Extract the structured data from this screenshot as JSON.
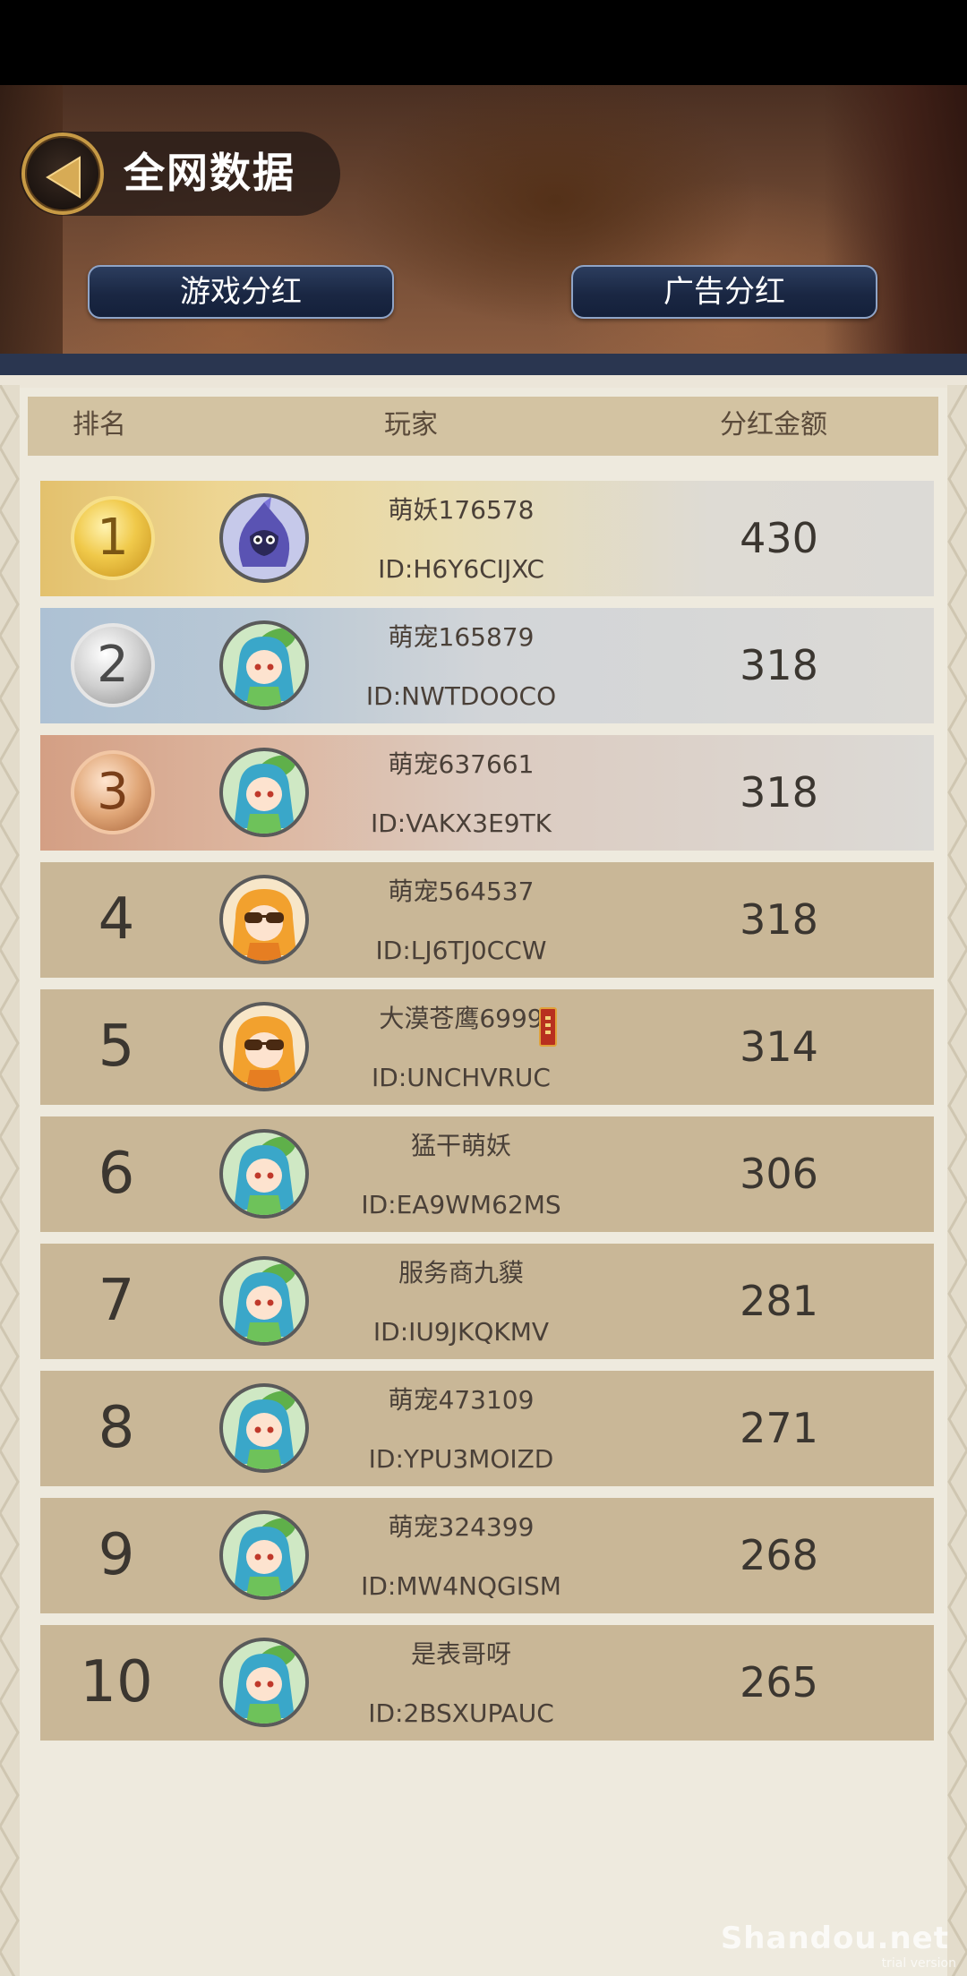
{
  "header": {
    "title": "全网数据",
    "tabs": [
      {
        "label": "游戏分红"
      },
      {
        "label": "广告分红"
      }
    ]
  },
  "table": {
    "columns": {
      "rank": "排名",
      "player": "玩家",
      "amount": "分红金额"
    },
    "rows": [
      {
        "rank": "1",
        "name": "萌妖176578",
        "id": "ID:H6Y6CIJXC",
        "amount": "430",
        "avatar": "hooded-ninja-avatar",
        "style": "gold"
      },
      {
        "rank": "2",
        "name": "萌宠165879",
        "id": "ID:NWTDOOCO",
        "amount": "318",
        "avatar": "leaf-girl-avatar",
        "style": "silver"
      },
      {
        "rank": "3",
        "name": "萌宠637661",
        "id": "ID:VAKX3E9TK",
        "amount": "318",
        "avatar": "leaf-girl-avatar",
        "style": "bronze"
      },
      {
        "rank": "4",
        "name": "萌宠564537",
        "id": "ID:LJ6TJ0CCW",
        "amount": "318",
        "avatar": "sunglasses-girl-avatar",
        "style": "plain"
      },
      {
        "rank": "5",
        "name": "大漠苍鹰6999",
        "id": "ID:UNCHVRUC",
        "amount": "314",
        "avatar": "sunglasses-girl-avatar",
        "style": "plain",
        "badge": "red-seal-icon"
      },
      {
        "rank": "6",
        "name": "猛干萌妖",
        "id": "ID:EA9WM62MS",
        "amount": "306",
        "avatar": "leaf-girl-avatar",
        "style": "plain"
      },
      {
        "rank": "7",
        "name": "服务商九貘",
        "id": "ID:IU9JKQKMV",
        "amount": "281",
        "avatar": "leaf-girl-avatar",
        "style": "plain"
      },
      {
        "rank": "8",
        "name": "萌宠473109",
        "id": "ID:YPU3MOIZD",
        "amount": "271",
        "avatar": "leaf-girl-avatar",
        "style": "plain"
      },
      {
        "rank": "9",
        "name": "萌宠324399",
        "id": "ID:MW4NQGISM",
        "amount": "268",
        "avatar": "leaf-girl-avatar",
        "style": "plain"
      },
      {
        "rank": "10",
        "name": "是表哥呀",
        "id": "ID:2BSXUPAUC",
        "amount": "265",
        "avatar": "leaf-girl-avatar",
        "style": "plain"
      }
    ]
  },
  "watermark": {
    "text": "Shandou.net",
    "sub": "trial version"
  },
  "colors": {
    "header_bg": "#6b4631",
    "tab_bg": "#1a2743",
    "panel_bg": "#ece6d9",
    "row_bg": "#c9b797",
    "column_header_bg": "#d3c3a2",
    "gold": "#f0c94a",
    "silver": "#cfcfcf",
    "bronze": "#e0a677"
  }
}
